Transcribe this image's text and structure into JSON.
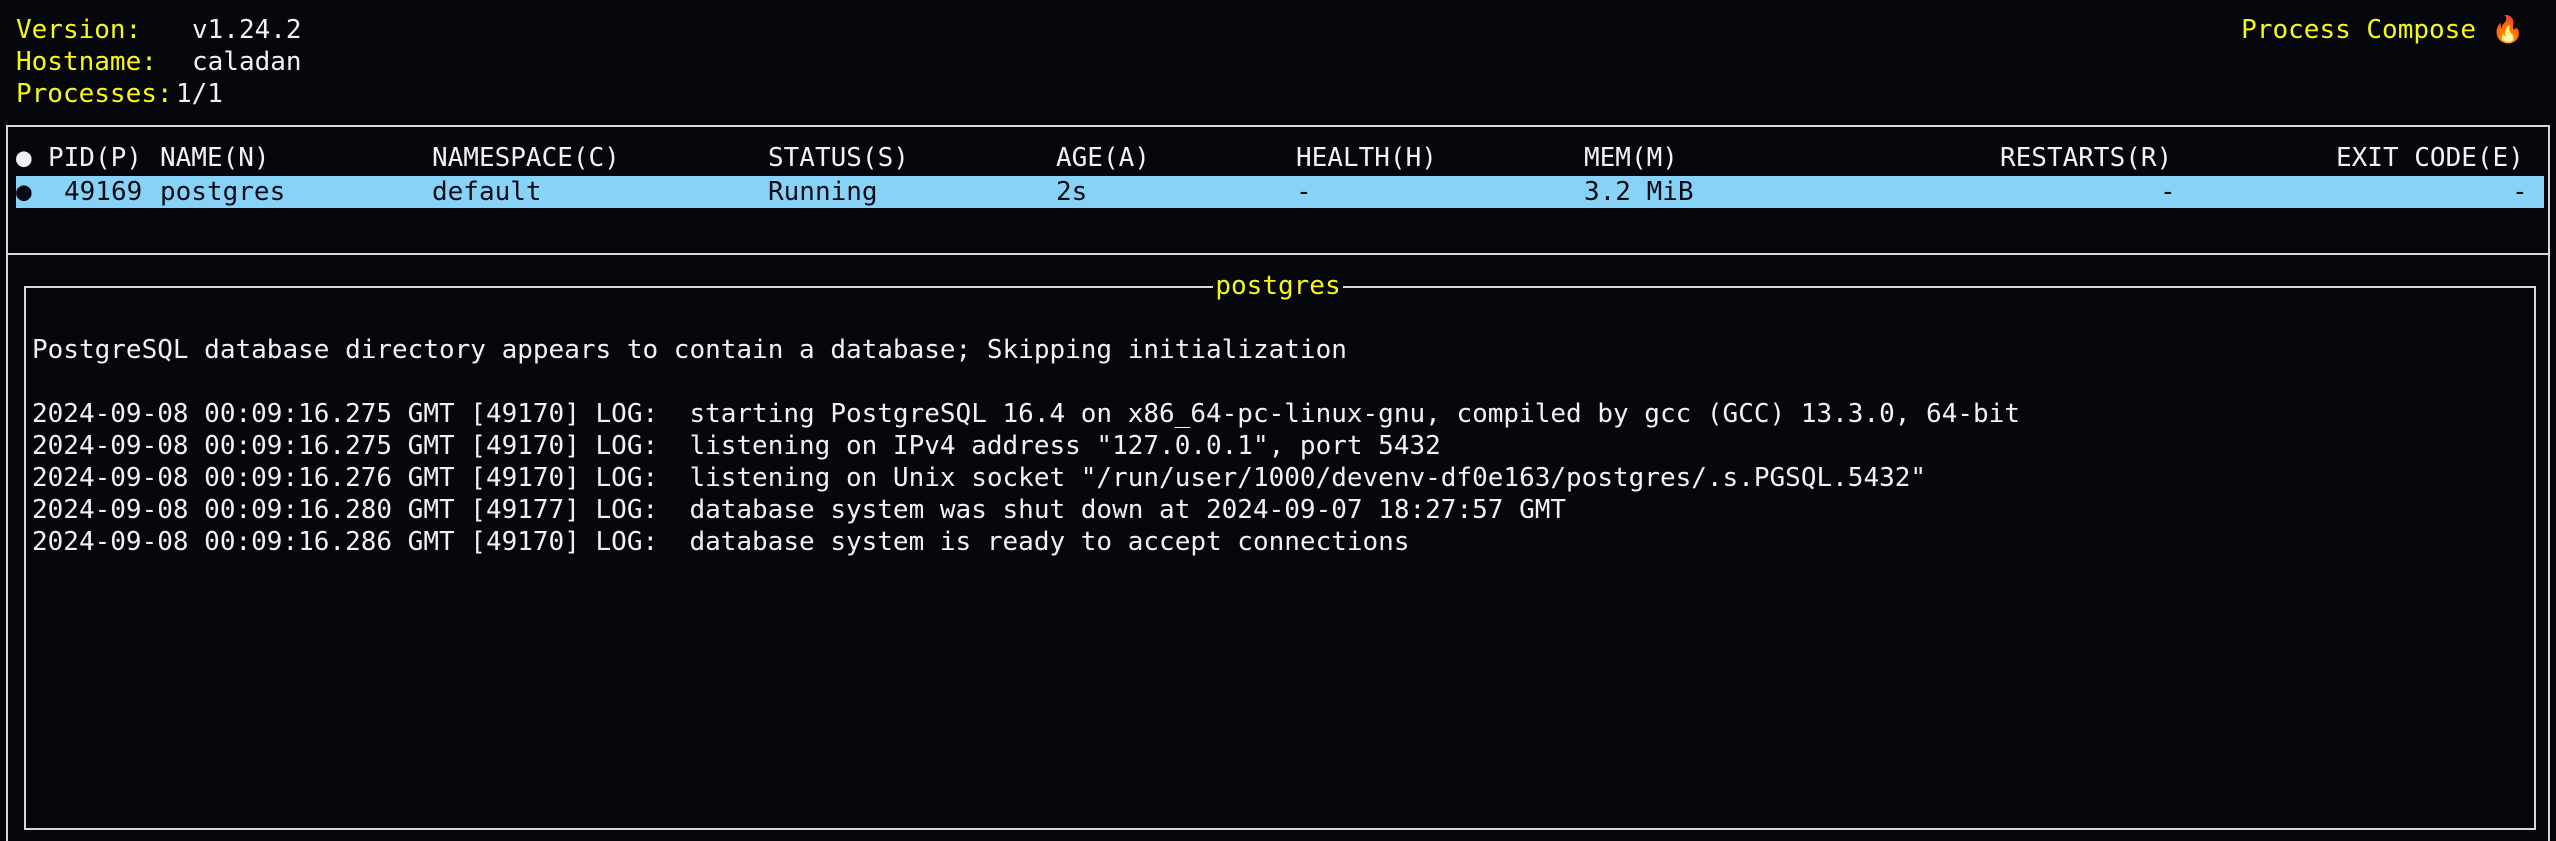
{
  "info": {
    "version_label": "Version:",
    "version_value": "v1.24.2",
    "hostname_label": "Hostname:",
    "hostname_value": "caladan",
    "processes_label": "Processes:",
    "processes_value": "1/1"
  },
  "app_title": "Process Compose 🔥",
  "table": {
    "header_bullet": "●",
    "columns": {
      "pid": "PID(P)",
      "name": "NAME(N)",
      "namespace": "NAMESPACE(C)",
      "status": "STATUS(S)",
      "age": "AGE(A)",
      "health": "HEALTH(H)",
      "mem": "MEM(M)",
      "restarts": "RESTARTS(R)",
      "exit_code": "EXIT CODE(E)"
    },
    "rows": [
      {
        "bullet": "●",
        "pid": "49169",
        "name": "postgres",
        "namespace": "default",
        "status": "Running",
        "age": "2s",
        "health": "-",
        "mem": "3.2 MiB",
        "restarts": "-",
        "exit_code": "-"
      }
    ]
  },
  "log": {
    "title": "postgres",
    "lines": [
      "PostgreSQL database directory appears to contain a database; Skipping initialization",
      "",
      "2024-09-08 00:09:16.275 GMT [49170] LOG:  starting PostgreSQL 16.4 on x86_64-pc-linux-gnu, compiled by gcc (GCC) 13.3.0, 64-bit",
      "2024-09-08 00:09:16.275 GMT [49170] LOG:  listening on IPv4 address \"127.0.0.1\", port 5432",
      "2024-09-08 00:09:16.276 GMT [49170] LOG:  listening on Unix socket \"/run/user/1000/devenv-df0e163/postgres/.s.PGSQL.5432\"",
      "2024-09-08 00:09:16.280 GMT [49177] LOG:  database system was shut down at 2024-09-07 18:27:57 GMT",
      "2024-09-08 00:09:16.286 GMT [49170] LOG:  database system is ready to accept connections"
    ]
  }
}
